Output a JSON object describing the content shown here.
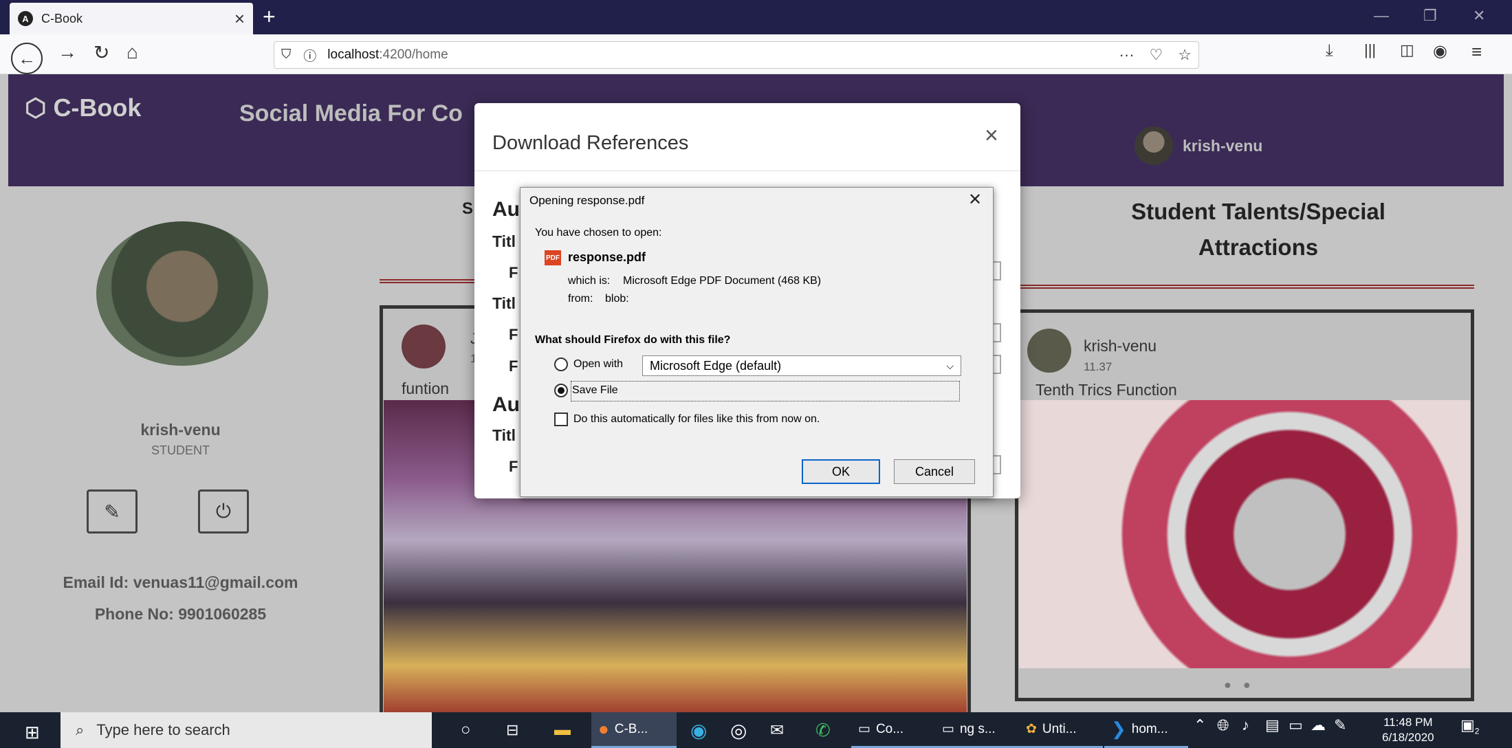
{
  "browser": {
    "tab_title": "C-Book",
    "tab_icon": "angular-icon",
    "tab_close": "×",
    "new_tab": "+",
    "url_host": "localhost",
    "url_path": ":4200/home",
    "page_actions": "···"
  },
  "app": {
    "brand": "C-Book",
    "tagline": "Social Media For Co",
    "header_user": "krish-venu"
  },
  "profile": {
    "name": "krish-venu",
    "role": "STUDENT",
    "email": "Email Id: venuas11@gmail.com",
    "phone": "Phone No: 9901060285"
  },
  "feed": {
    "left_heading_stub": "S",
    "left_post_title": "funtion",
    "left_post_author_stub": "J",
    "left_post_sub_stub": "1"
  },
  "talents": {
    "heading_line1": "Student Talents/Special",
    "heading_line2": "Attractions",
    "post_author": "krish-venu",
    "post_time": "11.37",
    "post_title": "Tenth Trics Function",
    "carousel_dots": "● ●"
  },
  "modal": {
    "title": "Download References",
    "close": "×",
    "stubs": [
      "Au",
      "Titl",
      "F",
      "Titl",
      "F",
      "F",
      "Au",
      "Titl",
      "F"
    ]
  },
  "dialog": {
    "title": "Opening response.pdf",
    "close": "✕",
    "chosen": "You have chosen to open:",
    "file_icon": "PDF",
    "filename": "response.pdf",
    "which_is_label": "which is:",
    "which_is_value": "Microsoft Edge PDF Document (468 KB)",
    "from_label": "from:",
    "from_value": "blob:",
    "question": "What should Firefox do with this file?",
    "open_with": "Open with",
    "open_with_app": "Microsoft Edge (default)",
    "save_file": "Save File",
    "auto": "Do this automatically for files like this from now on.",
    "ok": "OK",
    "cancel": "Cancel"
  },
  "taskbar": {
    "search_placeholder": "Type here to search",
    "apps": [
      "C-B...",
      "Co...",
      "ng s...",
      "Unti...",
      "hom..."
    ],
    "time": "11:48 PM",
    "date": "6/18/2020",
    "notifications": "2"
  }
}
